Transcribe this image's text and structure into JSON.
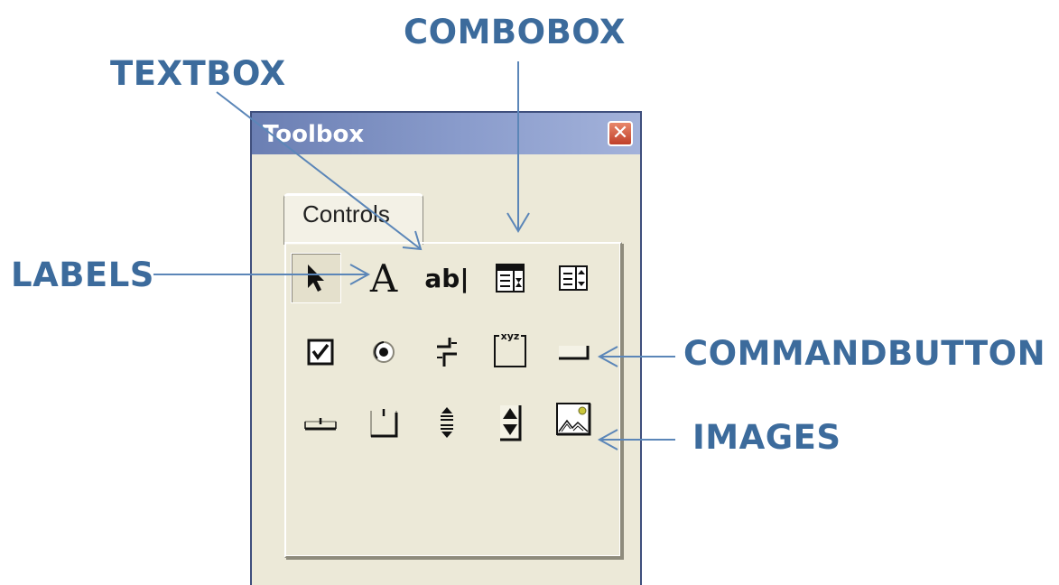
{
  "callouts": {
    "combobox": "COMBOBOX",
    "textbox": "TEXTBOX",
    "labels": "LABELS",
    "commandbutton": "COMMANDBUTTON",
    "images": "IMAGES"
  },
  "window": {
    "title": "Toolbox",
    "close_symbol": "✕",
    "tab_label": "Controls"
  },
  "tools": {
    "label_glyph": "A",
    "textbox_glyph": "ab|"
  },
  "colors": {
    "callout": "#3c6b9c",
    "titlebar": "#7f92c4",
    "window_bg": "#ece9d8",
    "close_button": "#d0553a"
  },
  "icons": [
    "pointer-icon",
    "label-icon",
    "textbox-icon",
    "combobox-icon",
    "listbox-icon",
    "checkbox-icon",
    "optionbutton-icon",
    "togglebutton-icon",
    "frame-icon",
    "commandbutton-icon",
    "tabstrip-icon",
    "multipage-icon",
    "scrollbar-icon",
    "spinbutton-icon",
    "image-icon"
  ]
}
